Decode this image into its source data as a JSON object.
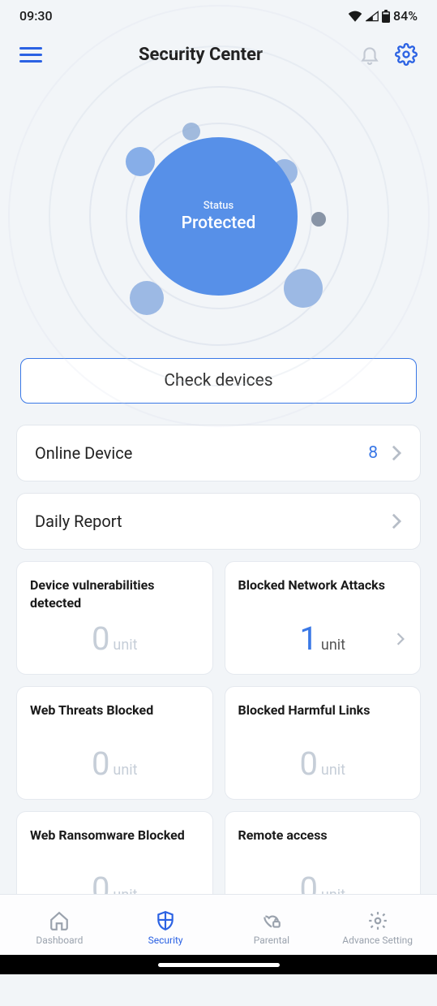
{
  "status_bar": {
    "time": "09:30",
    "battery_pct": "84%"
  },
  "header": {
    "title": "Security Center"
  },
  "hero": {
    "status_label": "Status",
    "status_value": "Protected"
  },
  "check_button_label": "Check devices",
  "rows": {
    "online_device": {
      "label": "Online Device",
      "value": "8"
    },
    "daily_report": {
      "label": "Daily Report"
    }
  },
  "unit_label": "unit",
  "stats": [
    {
      "title": "Device vulnerabilities detected",
      "value": "0",
      "active": false,
      "chevron": false
    },
    {
      "title": "Blocked Network Attacks",
      "value": "1",
      "active": true,
      "chevron": true
    },
    {
      "title": "Web Threats Blocked",
      "value": "0",
      "active": false,
      "chevron": false
    },
    {
      "title": "Blocked Harmful Links",
      "value": "0",
      "active": false,
      "chevron": false
    },
    {
      "title": "Web Ransomware Blocked",
      "value": "0",
      "active": false,
      "chevron": false
    },
    {
      "title": "Remote access",
      "value": "0",
      "active": false,
      "chevron": false
    }
  ],
  "nav": {
    "dashboard": "Dashboard",
    "security": "Security",
    "parental": "Parental",
    "advance": "Advance Setting"
  }
}
